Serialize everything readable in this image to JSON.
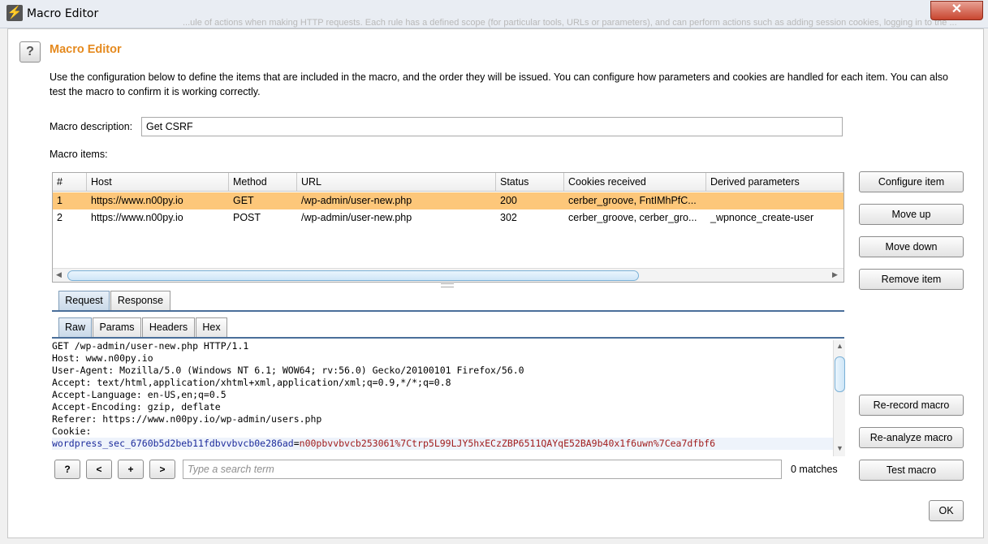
{
  "window": {
    "title": "Macro Editor",
    "close_glyph": "✕"
  },
  "background_text": "...ule of actions when making HTTP requests. Each rule has a defined scope (for particular tools, URLs or parameters), and can perform actions such as adding session cookies, logging in to the ...",
  "help_label": "?",
  "heading": "Macro Editor",
  "description": "Use the configuration below to define the items that are included in the macro, and the order they will be issued. You can configure how parameters and cookies are handled for each item. You can also test the macro to confirm it is working correctly.",
  "macro_description": {
    "label": "Macro description:",
    "value": "Get CSRF"
  },
  "macro_items_label": "Macro items:",
  "table": {
    "columns": [
      "#",
      "Host",
      "Method",
      "URL",
      "Status",
      "Cookies received",
      "Derived parameters"
    ],
    "rows": [
      {
        "num": "1",
        "host": "https://www.n00py.io",
        "method": "GET",
        "url": "/wp-admin/user-new.php",
        "status": "200",
        "cookies": "cerber_groove, FntIMhPfC...",
        "derived": ""
      },
      {
        "num": "2",
        "host": "https://www.n00py.io",
        "method": "POST",
        "url": "/wp-admin/user-new.php",
        "status": "302",
        "cookies": "cerber_groove, cerber_gro...",
        "derived": "_wpnonce_create-user"
      }
    ],
    "selected_row": 1
  },
  "side_buttons": {
    "configure": "Configure item",
    "move_up": "Move up",
    "move_down": "Move down",
    "remove": "Remove item",
    "rerecord": "Re-record macro",
    "reanalyze": "Re-analyze macro",
    "test": "Test macro"
  },
  "tabs_outer": {
    "request": "Request",
    "response": "Response",
    "active": "Request"
  },
  "tabs_inner": {
    "raw": "Raw",
    "params": "Params",
    "headers": "Headers",
    "hex": "Hex",
    "active": "Raw"
  },
  "editor": {
    "lines": [
      "GET /wp-admin/user-new.php HTTP/1.1",
      "Host: www.n00py.io",
      "User-Agent: Mozilla/5.0 (Windows NT 6.1; WOW64; rv:56.0) Gecko/20100101 Firefox/56.0",
      "Accept: text/html,application/xhtml+xml,application/xml;q=0.9,*/*;q=0.8",
      "Accept-Language: en-US,en;q=0.5",
      "Accept-Encoding: gzip, deflate",
      "Referer: https://www.n00py.io/wp-admin/users.php",
      "Cookie:"
    ],
    "cookie_name": "wordpress_sec_6760b5d2beb11fdbvvbvcb0e286ad",
    "cookie_eq": "=",
    "cookie_value": "n00pbvvbvcb253061%7Ctrp5L99LJY5hxECzZBP6511QAYqE52BA9b40x1f6uwn%7Cea7dfbf6"
  },
  "search": {
    "help": "?",
    "prev": "<",
    "add": "+",
    "next": ">",
    "placeholder": "Type a search term",
    "matches": "0 matches"
  },
  "ok_label": "OK"
}
